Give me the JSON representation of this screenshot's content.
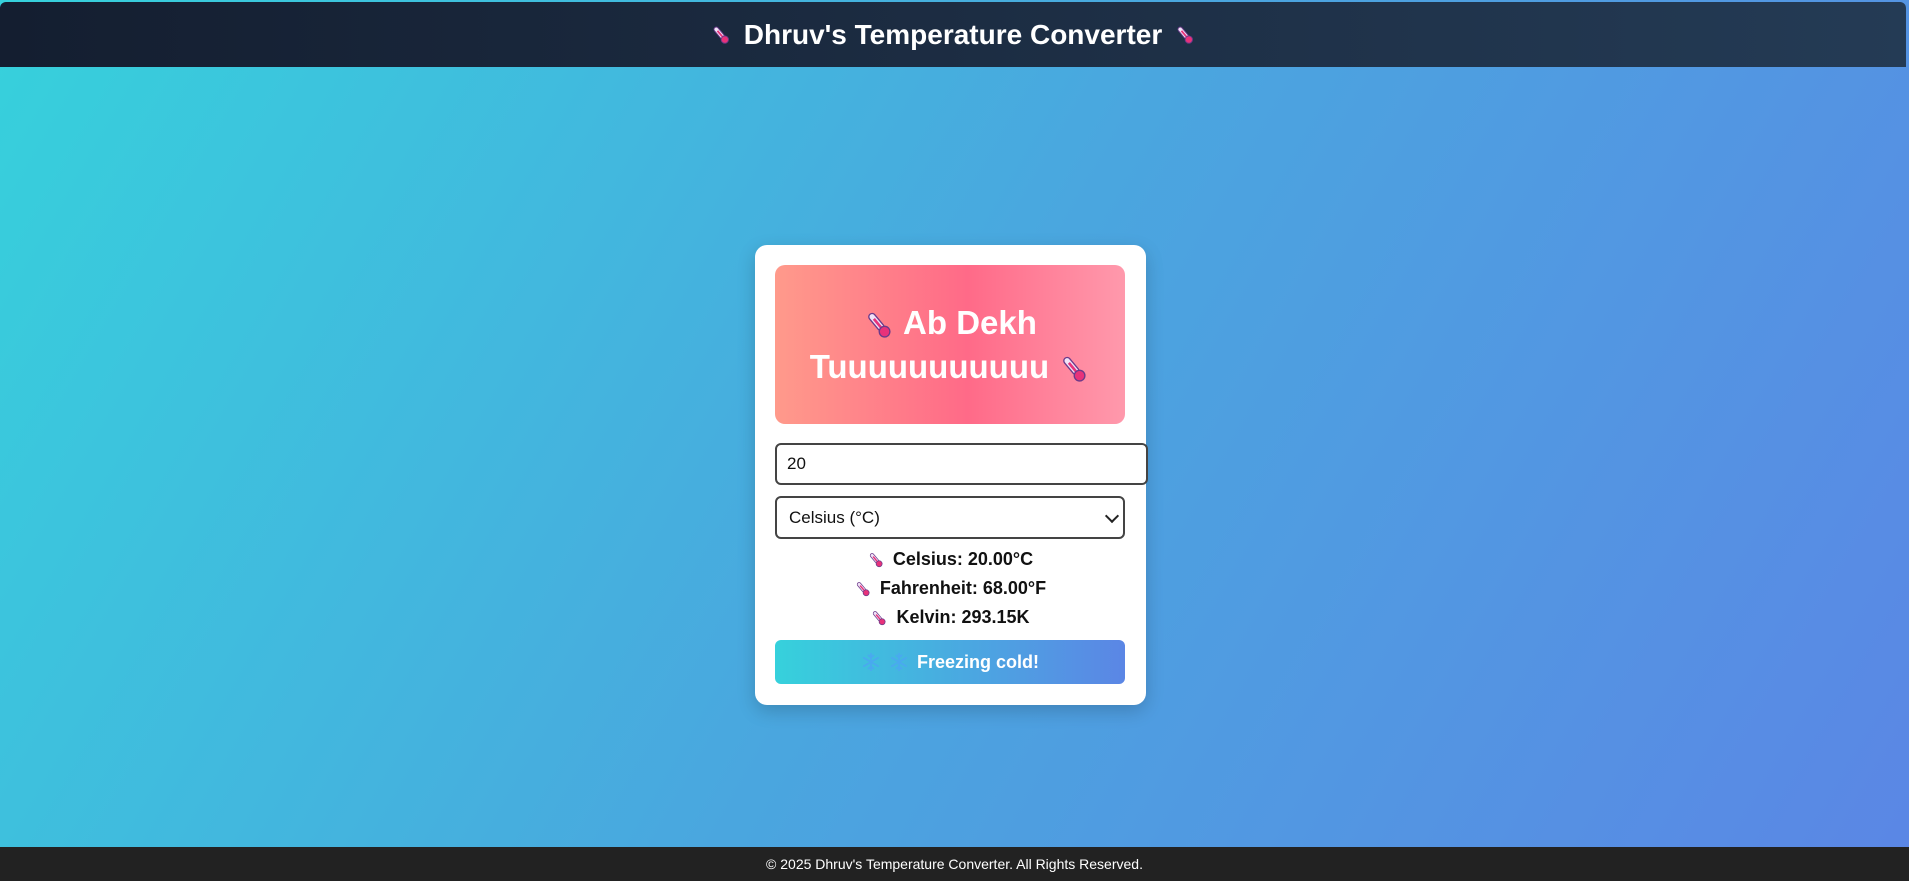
{
  "header": {
    "title": "Dhruv's Temperature Converter",
    "icon": "thermometer-icon"
  },
  "banner": {
    "text": "Ab Dekh Tuuuuuuuuuuu",
    "gradient": [
      "#ff9a8b",
      "#ff6a88",
      "#ff99ac"
    ]
  },
  "input": {
    "value": "20"
  },
  "unit_select": {
    "selected": "Celsius (°C)"
  },
  "results": {
    "celsius": "Celsius: 20.00°C",
    "fahrenheit": "Fahrenheit: 68.00°F",
    "kelvin": "Kelvin: 293.15K"
  },
  "status": {
    "text": "Freezing cold!",
    "icon": "snowflake-icon"
  },
  "footer": {
    "text": "© 2025 Dhruv's Temperature Converter. All Rights Reserved."
  },
  "colors": {
    "header_bg": [
      "#141e30",
      "#243b55"
    ],
    "page_bg": [
      "#36d1dc",
      "#5b86e5"
    ],
    "footer_bg": "#222222",
    "thermometer_accent": "#e8327a"
  }
}
